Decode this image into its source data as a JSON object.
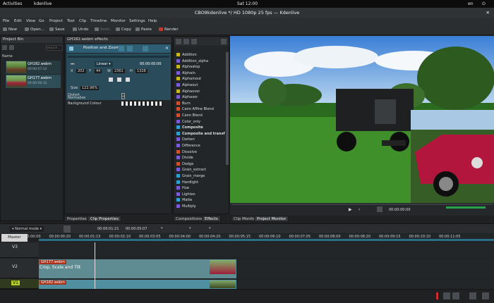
{
  "system_bar": {
    "activities": "Activities",
    "app": "kdenlive",
    "clock": "Sat 12:00",
    "locale": "en"
  },
  "window": {
    "title": "CBO9kdenlive */ HD 1080p 25 fps — Kdenlive"
  },
  "menu": [
    "File",
    "Edit",
    "View",
    "Go",
    "Project",
    "Tool",
    "Clip",
    "Timeline",
    "Monitor",
    "Settings",
    "Help"
  ],
  "toolbar": {
    "new": "New",
    "open": "Open...",
    "save": "Save",
    "undo": "Undo",
    "redo": "Redo",
    "copy": "Copy",
    "paste": "Paste",
    "render": "Render"
  },
  "project_bin": {
    "title": "Project Bin",
    "search_placeholder": "Search...",
    "column": "Name",
    "clips": [
      {
        "name": "GH182.webm",
        "duration": "00:00:07:12"
      },
      {
        "name": "GH177.webm",
        "duration": "00:00:06:12"
      }
    ]
  },
  "effects_panel": {
    "title": "GH182.webm effects",
    "effect_name": "Position and Zoom",
    "interp": "Linear",
    "time": "00:00:00:00",
    "x_label": "X",
    "x": "202",
    "y_label": "Y",
    "y": "44",
    "w_label": "W",
    "w": "2361",
    "h_label": "H",
    "h": "1328",
    "size_label": "Size",
    "size": "122.96%",
    "distort_label": "Distort",
    "normalise_label": "Normalise",
    "bg_label": "Background Colour"
  },
  "effects_list": [
    "Addition",
    "Addition_alpha",
    "Alphaatop",
    "Alphain",
    "Alphainout",
    "Alphaout",
    "Alphaover",
    "Alphaxor",
    "Burn",
    "Cairo Affine Blend",
    "Cairo Blend",
    "Color_only",
    "Composite",
    "Composite and transform",
    "Darken",
    "Difference",
    "Dissolve",
    "Divide",
    "Dodge",
    "Grain_extract",
    "Grain_merge",
    "Hardlight",
    "Hue",
    "Lighten",
    "Matte",
    "Multiply"
  ],
  "effects_colors": [
    "#c8b820",
    "#7a5cd8",
    "#c8b820",
    "#7a5cd8",
    "#c8b820",
    "#7a5cd8",
    "#c8b820",
    "#7a5cd8",
    "#d05030",
    "#d05030",
    "#d05030",
    "#7a5cd8",
    "#30a0d0",
    "#30a0d0",
    "#7a5cd8",
    "#7a5cd8",
    "#d05030",
    "#7a5cd8",
    "#d05030",
    "#7a5cd8",
    "#30a0d0",
    "#30a0d0",
    "#7a5cd8",
    "#7a5cd8",
    "#30a0d0",
    "#7a5cd8"
  ],
  "bottom_tabs": {
    "properties": "Properties",
    "clip_properties": "Clip Properties",
    "compositions": "Compositions",
    "effects": "Effects",
    "clip_monitor": "Clip Monitor",
    "project_monitor": "Project Monitor"
  },
  "monitor": {
    "timecode": "00:00:00:00"
  },
  "timeline": {
    "mode": "Normal mode",
    "position": "00:00:01:21",
    "duration": "00:00:05:07",
    "master": "Master",
    "ruler": [
      "00:00:00:00",
      "00:00:00:20",
      "00:00:01:15",
      "00:00:02:10",
      "00:00:03:05",
      "00:00:04:00",
      "00:00:04:20",
      "00:00:05:15",
      "00:00:06:10",
      "00:00:07:05",
      "00:00:08:00",
      "00:00:08:20",
      "00:00:09:15",
      "00:00:10:10",
      "00:00:11:05"
    ],
    "tracks": [
      "V3",
      "V2",
      "V1"
    ],
    "clip_v2_name": "GH177.webm",
    "clip_v2_effect": "Crop, Scale and Tilt",
    "clip_v1_name": "GH182.webm"
  }
}
